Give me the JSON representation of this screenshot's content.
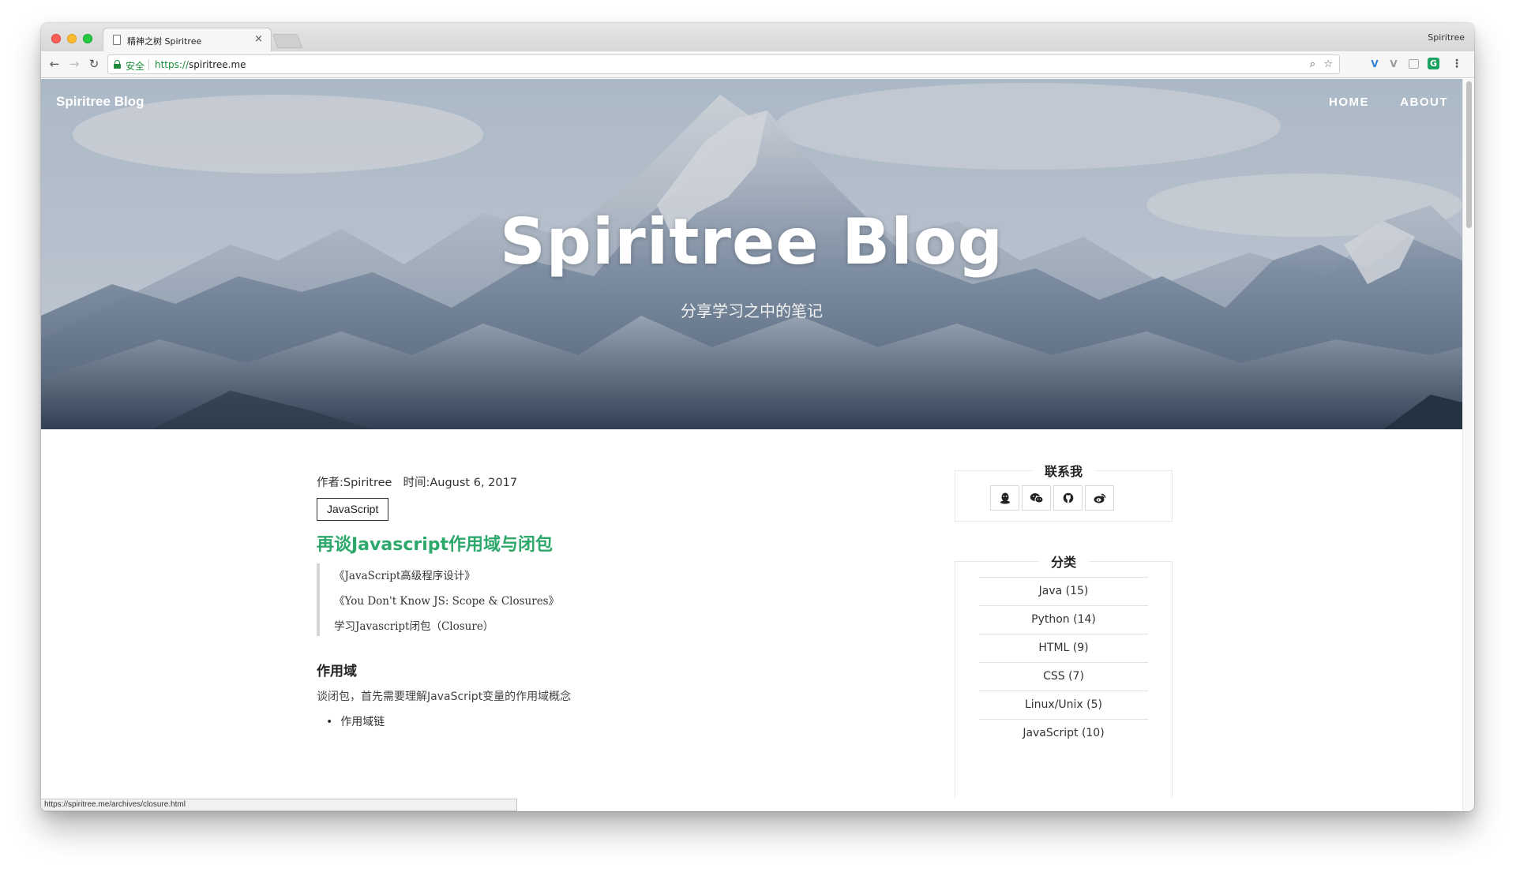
{
  "browser": {
    "tab_title": "精神之树 Spiritree",
    "tab_close": "×",
    "profile_name": "Spiritree",
    "secure_label": "安全",
    "url_scheme": "https://",
    "url_host": "spiritree.me",
    "status_url": "https://spiritree.me/archives/closure.html",
    "icons": [
      "back-arrow-icon",
      "forward-arrow-icon",
      "reload-icon",
      "lock-icon",
      "zoom-icon",
      "star-icon",
      "extension-icon",
      "menu-icon"
    ]
  },
  "site": {
    "brand": "Spiritree Blog",
    "nav": [
      {
        "label": "HOME"
      },
      {
        "label": "ABOUT"
      }
    ],
    "hero_title": "Spiritree Blog",
    "hero_subtitle": "分享学习之中的笔记"
  },
  "post": {
    "author": "作者:Spiritree",
    "time": "时间:August 6, 2017",
    "tag": "JavaScript",
    "title": "再谈Javascript作用域与闭包",
    "quotes": [
      "《JavaScript高级程序设计》",
      "《You Don't Know JS: Scope & Closures》",
      "学习Javascript闭包（Closure）"
    ],
    "section_heading": "作用域",
    "paragraph": "谈闭包，首先需要理解JavaScript变量的作用域概念",
    "bullets": [
      "作用域链"
    ]
  },
  "sidebar": {
    "contact_title": "联系我",
    "contact_icons": [
      "qq-icon",
      "wechat-icon",
      "github-icon",
      "weibo-icon"
    ],
    "categories_title": "分类",
    "categories": [
      {
        "label": "Java (15)"
      },
      {
        "label": "Python (14)"
      },
      {
        "label": "HTML (9)"
      },
      {
        "label": "CSS (7)"
      },
      {
        "label": "Linux/Unix (5)"
      },
      {
        "label": "JavaScript (10)"
      }
    ]
  },
  "colors": {
    "title_green": "#2ca86a",
    "secure_green": "#1d8a3a"
  }
}
